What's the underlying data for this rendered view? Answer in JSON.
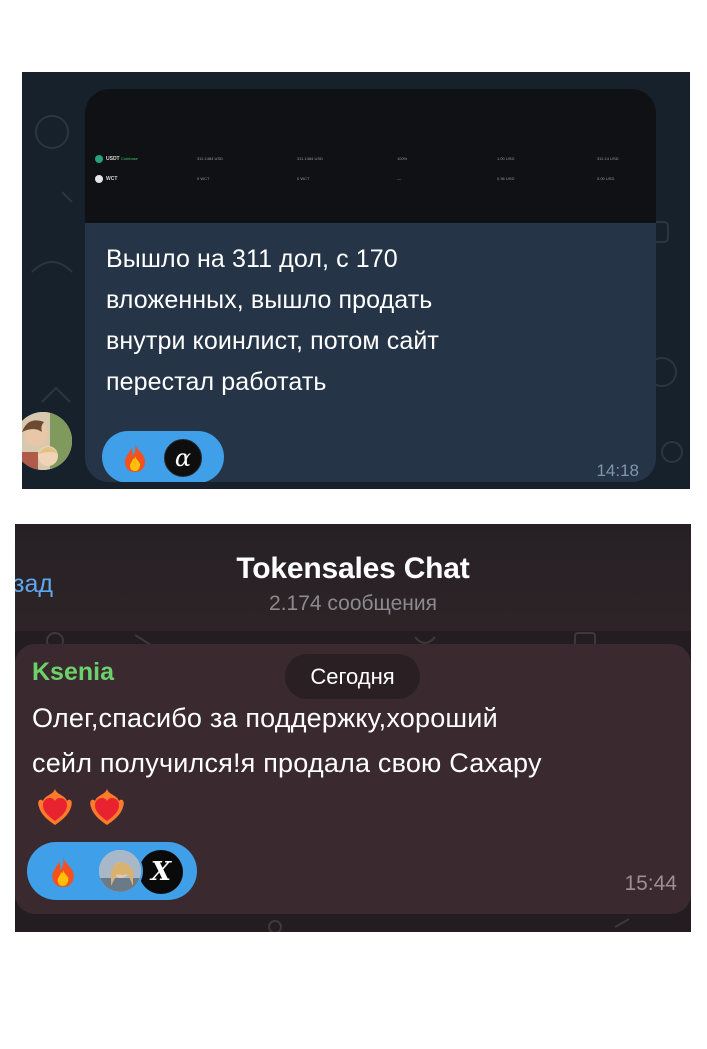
{
  "panel1": {
    "screenshot_table": {
      "rows": [
        {
          "coin": "USDT",
          "tag": "Coinbase",
          "cells": [
            "311.1484 USD",
            "311.1484 USD",
            "100%",
            "1.00 USD",
            "311.14 USD"
          ],
          "icon_color": "#26a17b"
        },
        {
          "coin": "WCT",
          "tag": "",
          "cells": [
            "0 WCT",
            "0 WCT",
            "—",
            "0.36 USD",
            "0.00 USD"
          ],
          "icon_color": "#e6e6e6"
        }
      ]
    },
    "message_lines": [
      "Вышло на 311 дол, с 170",
      "вложенных, вышло продать",
      "внутри коинлист, потом сайт",
      "перестал работать"
    ],
    "reactions": {
      "emoji_icon": "fire-emoji",
      "avatar_icon": "alpha-avatar",
      "avatar_glyph": "α"
    },
    "time": "14:18",
    "colors": {
      "background": "#17212b",
      "bubble": "#253547",
      "reaction_pill": "#3f9fe8"
    }
  },
  "panel2": {
    "header": {
      "back_label": "зад",
      "title": "Tokensales Chat",
      "subtitle": "2.174 сообщения"
    },
    "message": {
      "sender": "Ksenia",
      "date_pill": "Сегодня",
      "lines": [
        "Олег,спасибо за поддержку,хороший",
        "сейл получился!я продала свою Сахару"
      ],
      "emoji_line": [
        "heart-on-fire-emoji",
        "heart-on-fire-emoji"
      ],
      "reactions": {
        "emoji_icon": "fire-emoji",
        "avatar_glyph": "X"
      },
      "time": "15:44"
    },
    "colors": {
      "sender": "#6dd16b",
      "link": "#5ea8ef",
      "bubble": "#3a2a2f"
    }
  }
}
